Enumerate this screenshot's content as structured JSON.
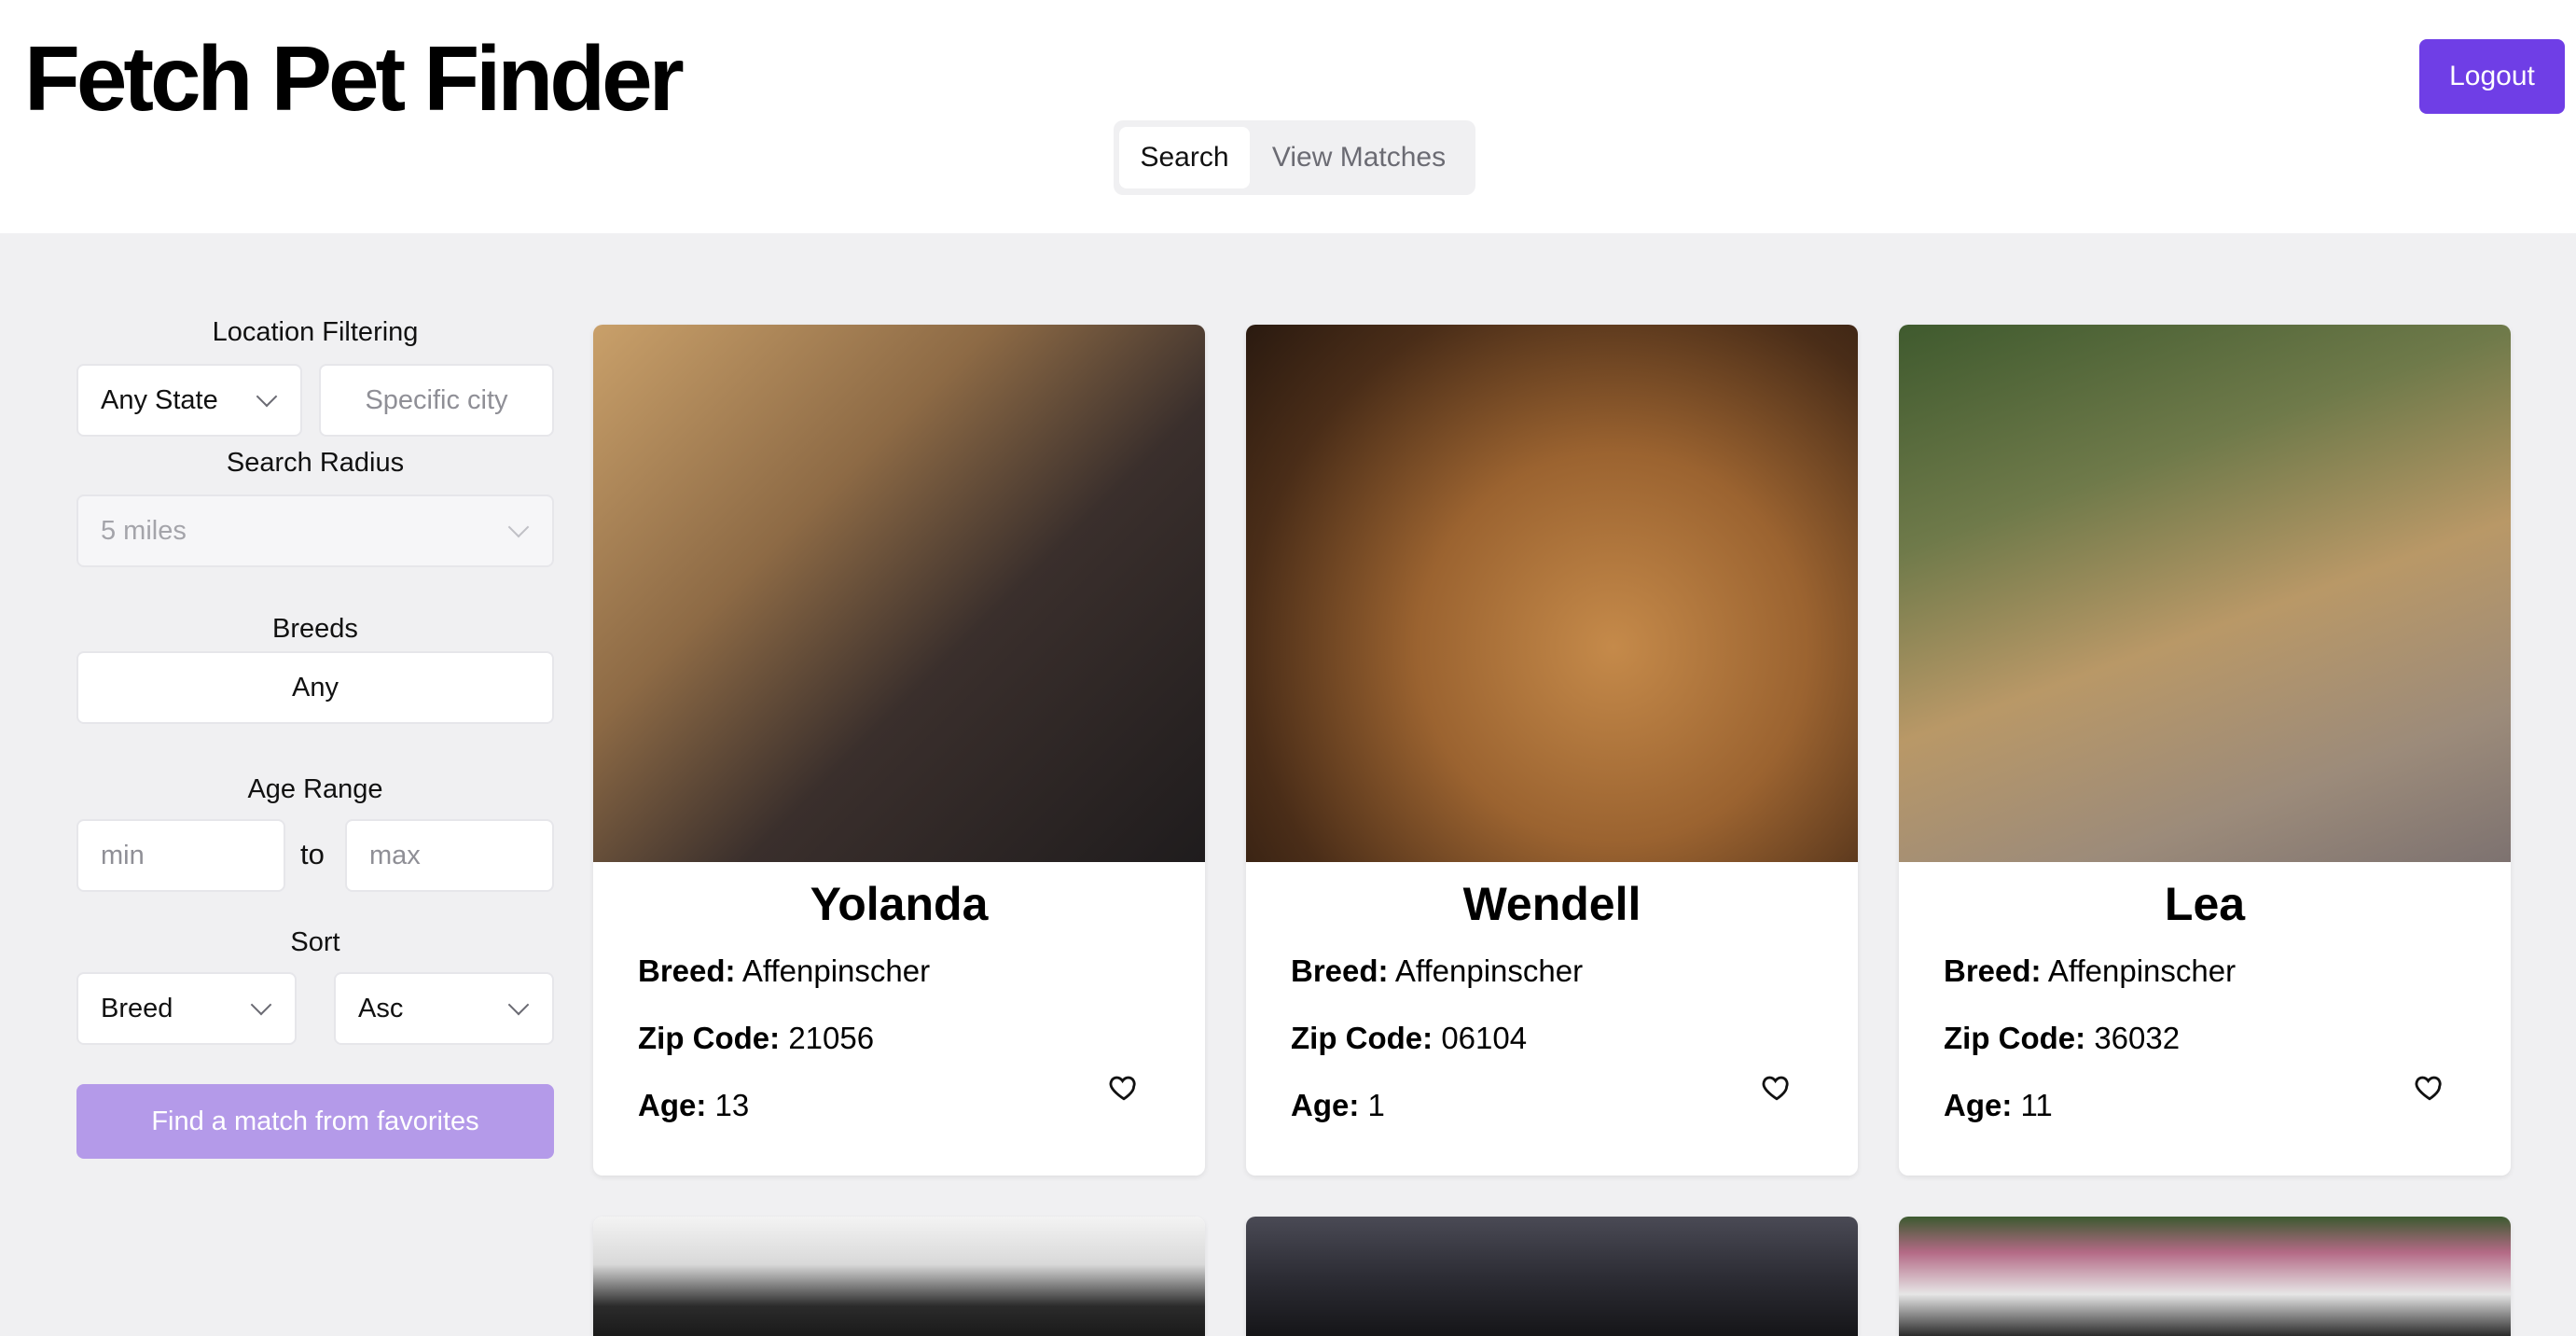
{
  "header": {
    "title": "Fetch Pet Finder",
    "logout_label": "Logout",
    "tabs": [
      {
        "label": "Search",
        "active": true
      },
      {
        "label": "View Matches",
        "active": false
      }
    ]
  },
  "sidebar": {
    "location_label": "Location Filtering",
    "state_select": "Any State",
    "city_placeholder": "Specific city",
    "radius_label": "Search Radius",
    "radius_select": "5 miles",
    "breeds_label": "Breeds",
    "breeds_value": "Any",
    "age_label": "Age Range",
    "age_min_placeholder": "min",
    "age_to": "to",
    "age_max_placeholder": "max",
    "sort_label": "Sort",
    "sort_field": "Breed",
    "sort_order": "Asc",
    "match_button": "Find a match from favorites"
  },
  "labels": {
    "breed": "Breed:",
    "zip": "Zip Code:",
    "age": "Age:"
  },
  "dogs": [
    {
      "name": "Yolanda",
      "breed": "Affenpinscher",
      "zip": "21056",
      "age": "13"
    },
    {
      "name": "Wendell",
      "breed": "Affenpinscher",
      "zip": "06104",
      "age": "1"
    },
    {
      "name": "Lea",
      "breed": "Affenpinscher",
      "zip": "36032",
      "age": "11"
    }
  ],
  "colors": {
    "accent": "#6f3ee6",
    "accent_muted": "#b49ae9",
    "page_bg": "#f0f0f2"
  },
  "icons": {
    "favorite": "heart-outline-icon",
    "dropdown": "chevron-down-icon"
  }
}
